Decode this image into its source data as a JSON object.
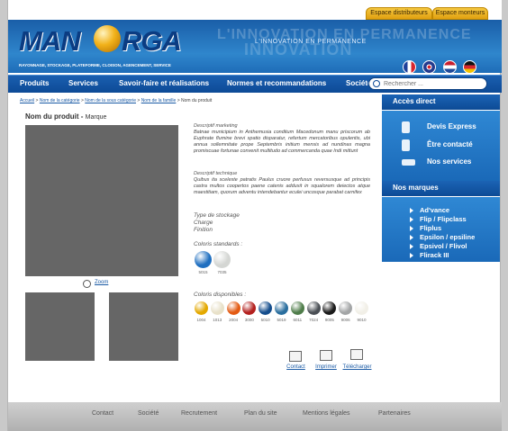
{
  "header": {
    "top_buttons": [
      "Espace distributeurs",
      "Espace monteurs"
    ],
    "logo_left": "MAN",
    "logo_right": "RGA",
    "tagline": "RAYONNAGE, STOCKAGE, PLATEFORME, CLOISON, AGENCEMENT, SERVICE",
    "slogan_big": "L'INNOVATION EN PERMANENCE",
    "slogan_big2": "INNOVATION",
    "slogan_small": "L'INNOVATION EN PERMANENCE",
    "flags": [
      "fr",
      "uk",
      "nl",
      "de"
    ]
  },
  "nav": {
    "items": [
      "Produits",
      "Services",
      "Savoir-faire et réalisations",
      "Normes et recommandations",
      "Société"
    ],
    "search_placeholder": "Rechercher ..."
  },
  "breadcrumb": {
    "items": [
      "Accueil",
      "Nom de la catégorie",
      "Nom de la sous catégorie",
      "Nom de la famille"
    ],
    "current": "Nom du produit",
    "separator": ">"
  },
  "product": {
    "name": "Nom du produit -",
    "brand": "Marque",
    "zoom_label": "Zoom",
    "marketing_title": "Descriptif marketing",
    "marketing_text": "Batnae municipium in Anthemusia conditum Macedonum manu priscorum ab Euphrate flumine brevi spatio disparatur, refertum mercatoribus opulentis, ubi annua sollemnitate prope Septembris initium mensis ad nundinas magna promiscuae fortunae convenit multitudo ad commercanda quae Indi mittunt",
    "technical_title": "Descriptif technique",
    "technical_text": "Quibus ita sceleste patratis Paulus cruore perfusus reversusque ad principis castra multos coopertos paene catenis adduxit in squalorem deiectos atque maestitiam, quorum adventu intendebantur eculei uncosque parabat carnifex",
    "specs": [
      "Type de stockage",
      "Charge",
      "Finition"
    ],
    "standard_colors_label": "Coloris standards :",
    "standard_colors": [
      {
        "code": "5015",
        "color": "#1f6fc0"
      },
      {
        "code": "7035",
        "color": "#d4d6d3"
      }
    ],
    "available_colors_label": "Coloris disponibles :",
    "available_colors": [
      {
        "code": "1004",
        "color": "#e3a800"
      },
      {
        "code": "1013",
        "color": "#e8e1c9"
      },
      {
        "code": "2004",
        "color": "#e35a12"
      },
      {
        "code": "3000",
        "color": "#b3201e"
      },
      {
        "code": "5010",
        "color": "#144d8c"
      },
      {
        "code": "5019",
        "color": "#2a6e9e"
      },
      {
        "code": "6011",
        "color": "#4f7d4a"
      },
      {
        "code": "7024",
        "color": "#4a4f55"
      },
      {
        "code": "9005",
        "color": "#1a1a1a"
      },
      {
        "code": "9006",
        "color": "#a3a5a6"
      },
      {
        "code": "9010",
        "color": "#f1efe7"
      }
    ],
    "actions": [
      "Contact",
      "Imprimer",
      "Télécharger"
    ]
  },
  "sidebar": {
    "direct_title": "Accès direct",
    "direct_links": [
      "Devis Express",
      "Être contacté",
      "Nos services"
    ],
    "brands_title": "Nos marques",
    "brands": [
      "Ad'vance",
      "Flip / Flipclass",
      "Fliplus",
      "Epsilon / epsiline",
      "Epsivol / Flivol",
      "Flirack III"
    ]
  },
  "footer": {
    "links": [
      "Contact",
      "Société",
      "Recrutement",
      "Plan du site",
      "Mentions légales",
      "Partenaires"
    ]
  }
}
